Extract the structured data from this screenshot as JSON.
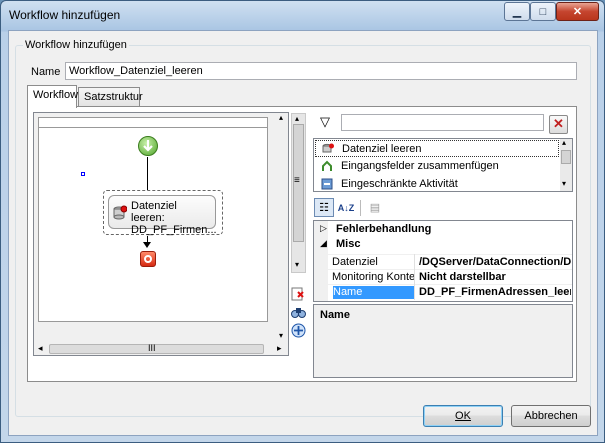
{
  "window": {
    "title": "Workflow hinzufügen"
  },
  "group": {
    "label": "Workflow hinzufügen"
  },
  "name_field": {
    "label": "Name",
    "value": "Workflow_Datenziel_leeren"
  },
  "tabs": [
    {
      "label": "Workflow",
      "active": true
    },
    {
      "label": "Satzstruktur",
      "active": false
    }
  ],
  "designer": {
    "node": {
      "line1": "Datenziel leeren:",
      "line2": "DD_PF_Firmen..."
    },
    "hscroll_label": "III"
  },
  "activities": {
    "items": [
      {
        "label": "Datenziel leeren",
        "icon": "datenziel-leeren-icon"
      },
      {
        "label": "Eingangsfelder zusammenfügen",
        "icon": "merge-fields-icon"
      },
      {
        "label": "Eingeschränkte Aktivität",
        "icon": "restricted-activity-icon"
      }
    ]
  },
  "properties": {
    "categories": [
      {
        "label": "Fehlerbehandlung",
        "expanded": false
      },
      {
        "label": "Misc",
        "expanded": true
      }
    ],
    "rows": [
      {
        "key": "Datenziel",
        "value": "/DQServer/DataConnection/Data"
      },
      {
        "key": "Monitoring Kontex",
        "value": "Nicht darstellbar"
      },
      {
        "key": "Name",
        "value": "DD_PF_FirmenAdressen_leeren",
        "selected": true
      }
    ],
    "description_title": "Name"
  },
  "buttons": {
    "ok": "OK",
    "cancel": "Abbrechen"
  }
}
